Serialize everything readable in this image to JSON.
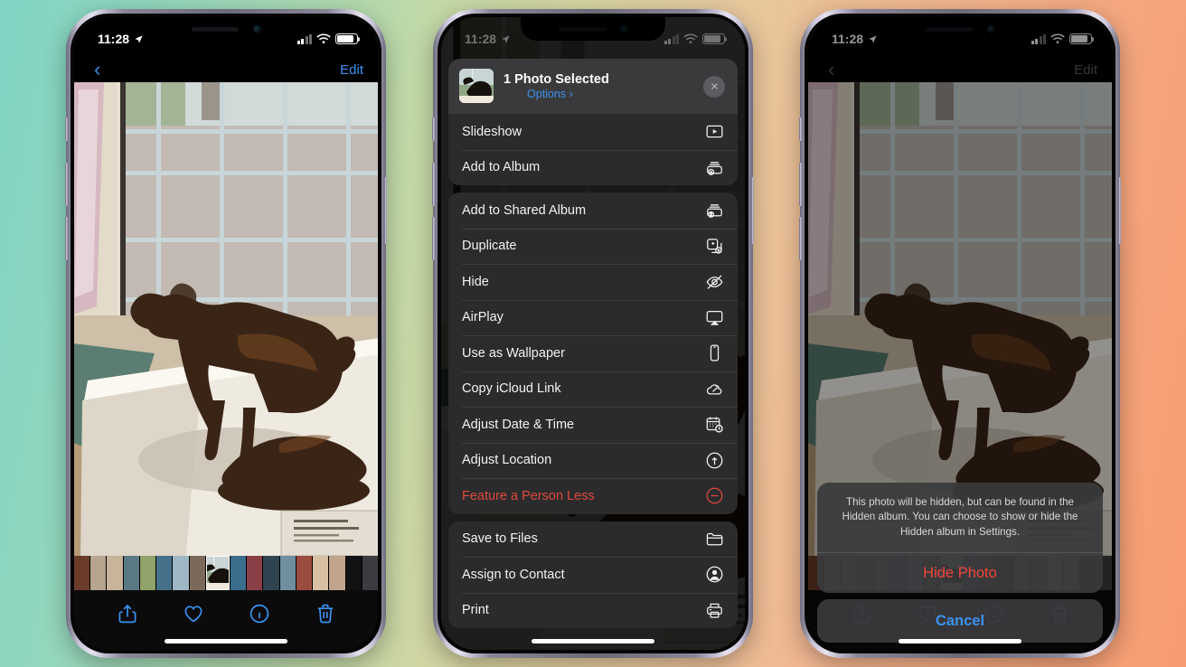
{
  "background": {
    "gradient_from": "#7fd4c4",
    "gradient_to": "#f79c72"
  },
  "status_bar": {
    "time": "11:28",
    "location_icon": "location-arrow-icon",
    "signal_icon": "cellular-signal-icon",
    "wifi_icon": "wifi-icon",
    "battery_icon": "battery-icon"
  },
  "phone1": {
    "nav": {
      "back_icon": "chevron-left-icon",
      "edit_label": "Edit"
    },
    "photo_alt": "Bronze dog sculpture on white pedestal in front of a window",
    "toolbar": [
      {
        "name": "share-button",
        "icon": "share-icon"
      },
      {
        "name": "favorite-button",
        "icon": "heart-icon"
      },
      {
        "name": "info-button",
        "icon": "info-circle-icon"
      },
      {
        "name": "delete-button",
        "icon": "trash-icon"
      }
    ]
  },
  "phone2": {
    "sheet": {
      "title": "1 Photo Selected",
      "options_label": "Options",
      "options_chevron": "›",
      "close_icon": "close-x-icon",
      "groups": [
        {
          "items": [
            {
              "label": "Slideshow",
              "icon": "slideshow-icon",
              "destructive": false
            },
            {
              "label": "Add to Album",
              "icon": "add-to-album-icon",
              "destructive": false
            }
          ]
        },
        {
          "items": [
            {
              "label": "Add to Shared Album",
              "icon": "shared-album-icon",
              "destructive": false
            },
            {
              "label": "Duplicate",
              "icon": "duplicate-icon",
              "destructive": false
            },
            {
              "label": "Hide",
              "icon": "eye-slash-icon",
              "destructive": false
            },
            {
              "label": "AirPlay",
              "icon": "airplay-icon",
              "destructive": false
            },
            {
              "label": "Use as Wallpaper",
              "icon": "iphone-icon",
              "destructive": false
            },
            {
              "label": "Copy iCloud Link",
              "icon": "icloud-link-icon",
              "destructive": false
            },
            {
              "label": "Adjust Date & Time",
              "icon": "calendar-clock-icon",
              "destructive": false
            },
            {
              "label": "Adjust Location",
              "icon": "location-circle-icon",
              "destructive": false
            },
            {
              "label": "Feature a Person Less",
              "icon": "minus-circle-icon",
              "destructive": true
            }
          ]
        },
        {
          "items": [
            {
              "label": "Save to Files",
              "icon": "folder-icon",
              "destructive": false
            },
            {
              "label": "Assign to Contact",
              "icon": "person-circle-icon",
              "destructive": false
            },
            {
              "label": "Print",
              "icon": "printer-icon",
              "destructive": false
            }
          ]
        }
      ]
    }
  },
  "phone3": {
    "nav": {
      "back_icon": "chevron-left-icon",
      "edit_label": "Edit"
    },
    "alert": {
      "message": "This photo will be hidden, but can be found in the Hidden album. You can choose to show or hide the Hidden album in Settings.",
      "confirm_label": "Hide Photo",
      "cancel_label": "Cancel"
    }
  },
  "colors": {
    "accent_blue": "#3b92f0",
    "destructive_red": "#e0493c",
    "alert_red": "#f0473a",
    "sheet_group_bg": "#2b2b2d",
    "sheet_head_bg": "#3a3a3c"
  }
}
